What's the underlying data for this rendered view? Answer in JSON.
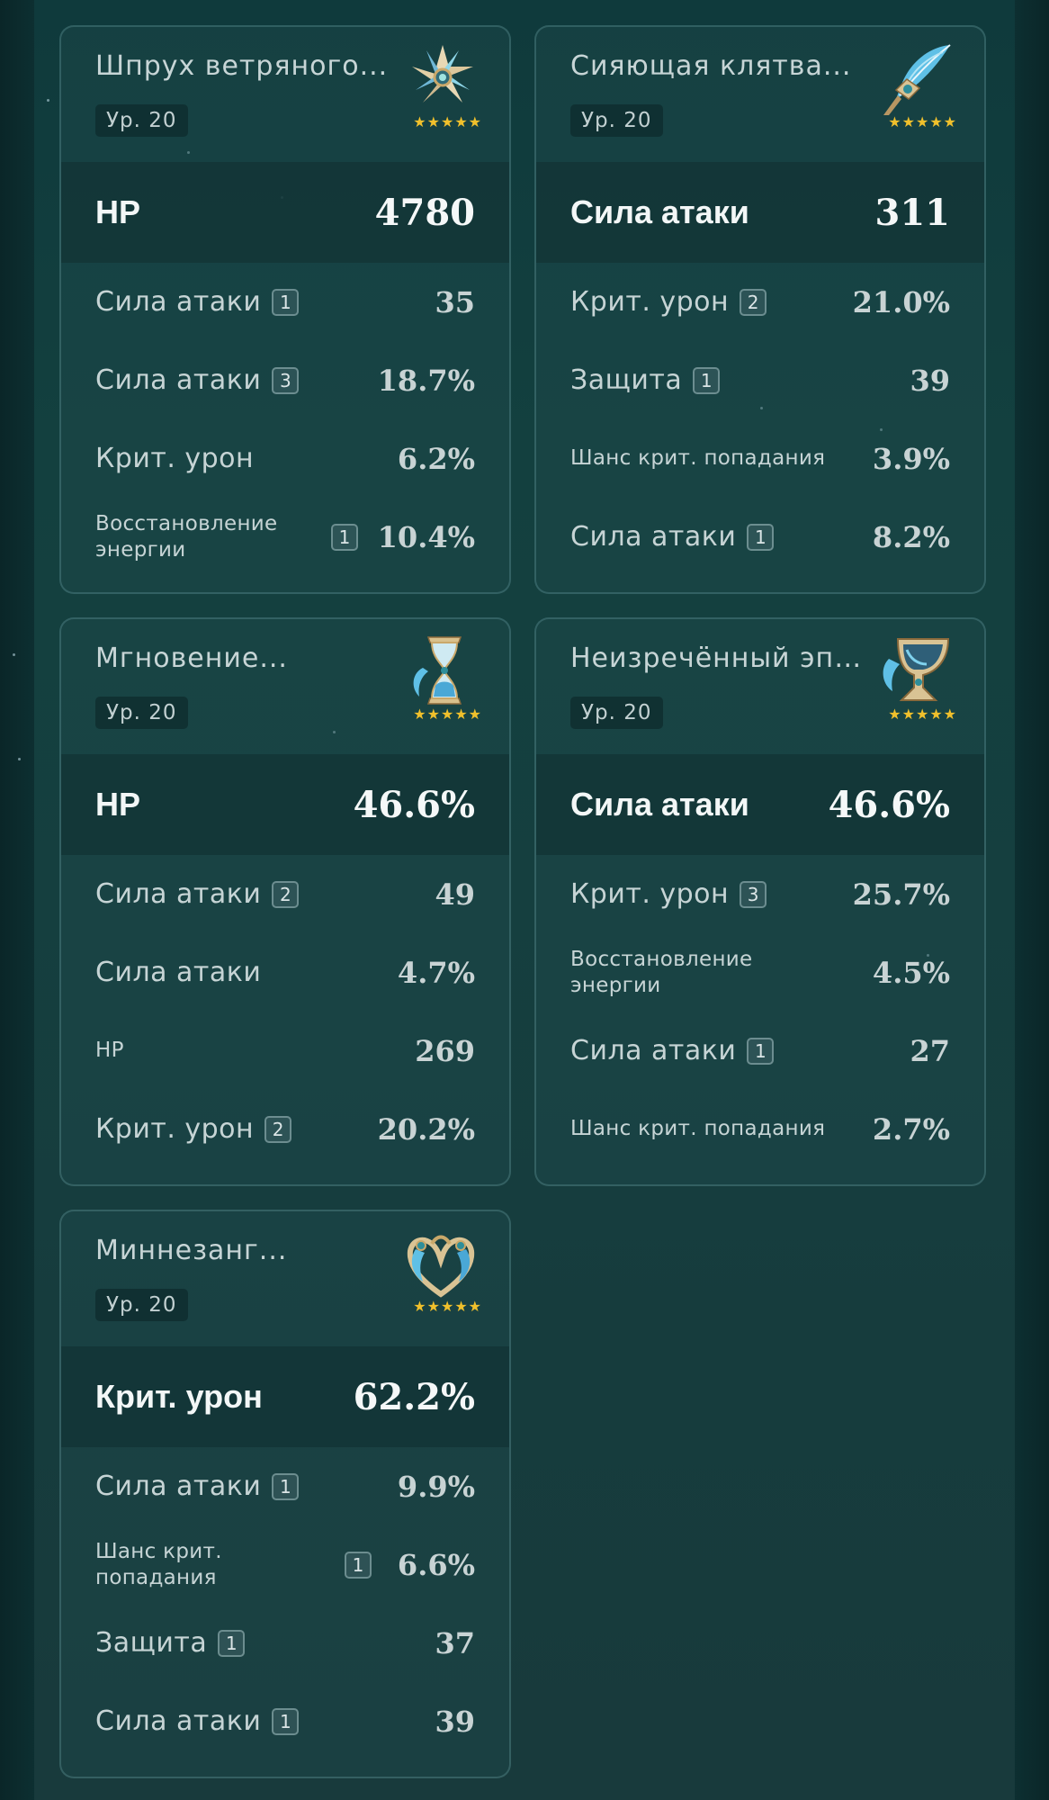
{
  "artifacts": [
    {
      "name": "Шпрух ветряного...",
      "level": "Ур. 20",
      "stars": "★★★★★",
      "icon": "flower-artifact-icon",
      "main_stat": {
        "name": "HP",
        "value": "4780"
      },
      "sub_stats": [
        {
          "name": "Сила атаки",
          "rolls": "1",
          "value": "35"
        },
        {
          "name": "Сила атаки",
          "rolls": "3",
          "value": "18.7%"
        },
        {
          "name": "Крит. урон",
          "rolls": "",
          "value": "6.2%"
        },
        {
          "name": "Восстановление энергии",
          "rolls": "1",
          "value": "10.4%"
        }
      ]
    },
    {
      "name": "Сияющая клятва...",
      "level": "Ур. 20",
      "stars": "★★★★★",
      "icon": "feather-artifact-icon",
      "main_stat": {
        "name": "Сила атаки",
        "value": "311"
      },
      "sub_stats": [
        {
          "name": "Крит. урон",
          "rolls": "2",
          "value": "21.0%"
        },
        {
          "name": "Защита",
          "rolls": "1",
          "value": "39"
        },
        {
          "name": "Шанс крит. попадания",
          "rolls": "",
          "value": "3.9%"
        },
        {
          "name": "Сила атаки",
          "rolls": "1",
          "value": "8.2%"
        }
      ]
    },
    {
      "name": "Мгновение...",
      "level": "Ур. 20",
      "stars": "★★★★★",
      "icon": "sands-artifact-icon",
      "main_stat": {
        "name": "HP",
        "value": "46.6%"
      },
      "sub_stats": [
        {
          "name": "Сила атаки",
          "rolls": "2",
          "value": "49"
        },
        {
          "name": "Сила атаки",
          "rolls": "",
          "value": "4.7%"
        },
        {
          "name": "HP",
          "rolls": "",
          "value": "269"
        },
        {
          "name": "Крит. урон",
          "rolls": "2",
          "value": "20.2%"
        }
      ]
    },
    {
      "name": "Неизречённый эпос...",
      "level": "Ур. 20",
      "stars": "★★★★★",
      "icon": "goblet-artifact-icon",
      "main_stat": {
        "name": "Сила атаки",
        "value": "46.6%"
      },
      "sub_stats": [
        {
          "name": "Крит. урон",
          "rolls": "3",
          "value": "25.7%"
        },
        {
          "name": "Восстановление энергии",
          "rolls": "",
          "value": "4.5%"
        },
        {
          "name": "Сила атаки",
          "rolls": "1",
          "value": "27"
        },
        {
          "name": "Шанс крит. попадания",
          "rolls": "",
          "value": "2.7%"
        }
      ]
    },
    {
      "name": "Миннезанг...",
      "level": "Ур. 20",
      "stars": "★★★★★",
      "icon": "circlet-artifact-icon",
      "main_stat": {
        "name": "Крит. урон",
        "value": "62.2%"
      },
      "sub_stats": [
        {
          "name": "Сила атаки",
          "rolls": "1",
          "value": "9.9%"
        },
        {
          "name": "Шанс крит. попадания",
          "rolls": "1",
          "value": "6.6%"
        },
        {
          "name": "Защита",
          "rolls": "1",
          "value": "37"
        },
        {
          "name": "Сила атаки",
          "rolls": "1",
          "value": "39"
        }
      ]
    }
  ],
  "colors": {
    "background": "#13403f",
    "star": "#f0c02c",
    "main_text": "#f3f7f7",
    "sub_text": "#c6d4d5"
  }
}
